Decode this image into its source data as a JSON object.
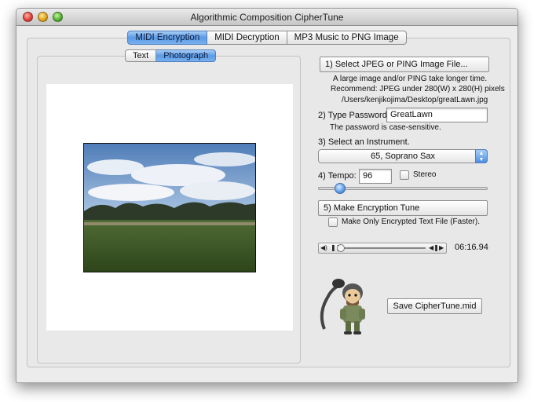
{
  "window": {
    "title": "Algorithmic Composition CipherTune"
  },
  "main_tabs": [
    {
      "label": "MIDI Encryption",
      "active": true
    },
    {
      "label": "MIDI Decryption",
      "active": false
    },
    {
      "label": "MP3 Music to PNG Image",
      "active": false
    }
  ],
  "sub_tabs": [
    {
      "label": "Text",
      "active": false
    },
    {
      "label": "Photograph",
      "active": true
    }
  ],
  "step1": {
    "button": "1) Select JPEG or PING Image File...",
    "note1": "A large image and/or PING take longer time.",
    "note2": "Recommend: JPEG under 280(W) x 280(H) pixels",
    "path": "/Users/kenjikojima/Desktop/greatLawn.jpg"
  },
  "step2": {
    "label": "2) Type Password:",
    "value": "GreatLawn",
    "note": "The password is case-sensitive."
  },
  "step3": {
    "label": "3) Select an Instrument.",
    "selected": "65, Soprano Sax"
  },
  "step4": {
    "label": "4) Tempo:",
    "value": "96",
    "stereo_label": "Stereo",
    "stereo_checked": false,
    "slider_fraction": 0.13
  },
  "step5": {
    "button": "5) Make Encryption Tune",
    "checkbox_label": "Make Only Encrypted Text File (Faster).",
    "checkbox_checked": false
  },
  "player": {
    "time": "06:16.94",
    "progress_fraction": 0.0
  },
  "save_button": "Save CipherTune.mid",
  "icons": [
    "close-icon",
    "minimize-icon",
    "zoom-icon",
    "play-icon",
    "pause-icon",
    "rewind-icon",
    "forward-icon",
    "mascot-icon",
    "dropdown-arrow-icon"
  ],
  "colors": {
    "accent": "#5b9ae6",
    "window_bg": "#ececec"
  }
}
